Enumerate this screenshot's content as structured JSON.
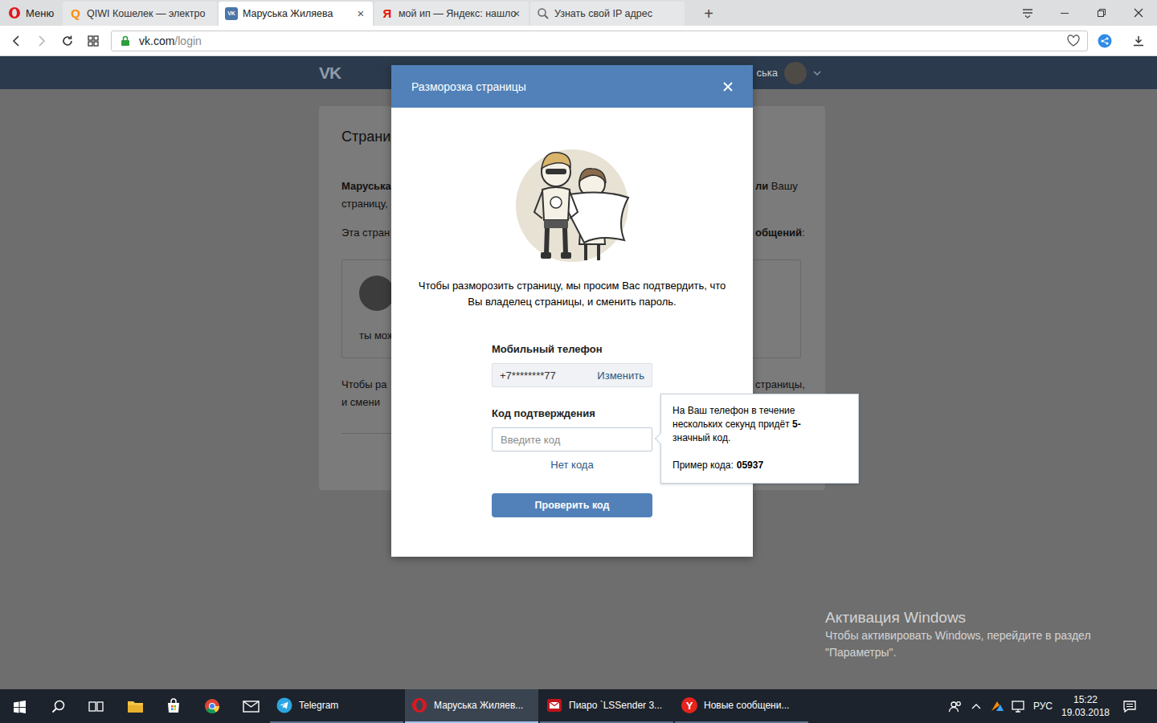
{
  "browser": {
    "menu": "Меню",
    "tabs": [
      {
        "label": "QIWI Кошелек — электро",
        "icon": "Q",
        "kind": "qiwi",
        "closable": false,
        "selected": false
      },
      {
        "label": "Маруська Жиляева",
        "icon": "VK",
        "kind": "vk",
        "closable": true,
        "selected": true
      },
      {
        "label": "мой ип — Яндекс: нашло",
        "icon": "Я",
        "kind": "yandex",
        "closable": true,
        "selected": false
      },
      {
        "label": "Узнать свой IP адрес",
        "kind": "search",
        "closable": false,
        "selected": false
      }
    ],
    "close_glyph": "×",
    "new_tab": "+",
    "address": {
      "host": "vk.com",
      "path": "/login",
      "secure": true
    }
  },
  "vk": {
    "logo": "VK",
    "user": "ська",
    "card": {
      "title": "Страни",
      "blocks": [
        {
          "lines": [
            {
              "left": [
                {
                  "text": "Маруська",
                  "bold": true
                }
              ],
              "right": [
                {
                  "text": "ли",
                  "bold": true
                },
                {
                  "text": " Вашу",
                  "bold": false
                }
              ]
            },
            {
              "left": [
                {
                  "text": "страницу,",
                  "bold": false
                }
              ],
              "right": []
            }
          ]
        },
        {
          "lines": [
            {
              "left": [
                {
                  "text": "Эта стран",
                  "bold": false
                }
              ],
              "right": [
                {
                  "text": "общений",
                  "bold": true
                },
                {
                  "text": ":",
                  "bold": false
                }
              ]
            }
          ]
        }
      ],
      "message": {
        "text": "ты мож"
      },
      "footer": {
        "lines": [
          {
            "left": [
              {
                "text": "Чтобы ра",
                "bold": false
              }
            ],
            "right": [
              {
                "text": "страницы,",
                "bold": false
              }
            ]
          },
          {
            "left": [
              {
                "text": "и смени",
                "bold": false
              }
            ],
            "right": []
          }
        ]
      }
    }
  },
  "modal": {
    "title": "Разморозка страницы",
    "text_lines": [
      "Чтобы разморозить страницу, мы просим Вас подтвердить, что",
      "Вы владелец страницы, и сменить пароль."
    ],
    "phone": {
      "label": "Мобильный телефон",
      "value": "+7********77",
      "change": "Изменить"
    },
    "code": {
      "label": "Код подтверждения",
      "placeholder": "Введите код"
    },
    "no_code": "Нет кода",
    "submit": "Проверить код"
  },
  "tooltip": {
    "lines": [
      [
        {
          "text": "На Ваш телефон в течение",
          "bold": false
        }
      ],
      [
        {
          "text": "нескольких секунд придёт ",
          "bold": false
        },
        {
          "text": "5-",
          "bold": true
        }
      ],
      [
        {
          "text": "значный код.",
          "bold": false
        }
      ]
    ],
    "example": {
      "label": "Пример кода:",
      "code": "05937"
    }
  },
  "watermark": {
    "title": "Активация Windows",
    "lines": [
      "Чтобы активировать Windows, перейдите в раздел",
      "\"Параметры\"."
    ]
  },
  "taskbar": {
    "pinned": [
      {
        "kind": "start"
      },
      {
        "kind": "search"
      },
      {
        "kind": "task-view"
      },
      {
        "kind": "explorer"
      },
      {
        "kind": "store"
      },
      {
        "kind": "chrome"
      },
      {
        "kind": "mail"
      }
    ],
    "windows": [
      {
        "label": "Telegram",
        "kind": "telegram",
        "selected": false
      },
      {
        "label": "Маруська Жиляев...",
        "kind": "opera",
        "selected": true
      },
      {
        "label": "Пиаро `LSSender 3...",
        "kind": "lssender",
        "selected": false
      },
      {
        "label": "Новые сообщени...",
        "kind": "yandex",
        "icon": "Y",
        "selected": false
      }
    ],
    "tray": {
      "icons": [
        {
          "kind": "people"
        },
        {
          "kind": "chevron"
        },
        {
          "kind": "app"
        },
        {
          "kind": "network"
        }
      ],
      "language": "РУС",
      "time": "15:22",
      "date": "19.03.2018",
      "action_center": {
        "kind": "action-center"
      }
    }
  }
}
